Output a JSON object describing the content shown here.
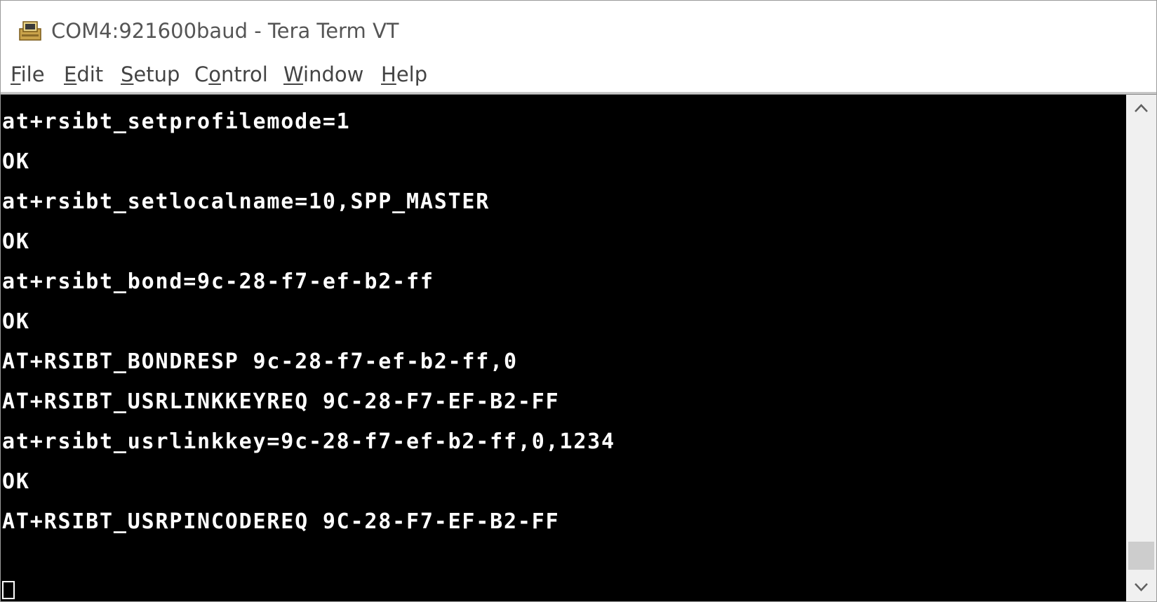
{
  "window": {
    "title": "COM4:921600baud - Tera Term VT"
  },
  "menu": {
    "items": [
      {
        "mnemonic": "F",
        "rest": "ile"
      },
      {
        "mnemonic": "E",
        "rest": "dit"
      },
      {
        "mnemonic": "S",
        "rest": "etup"
      },
      {
        "pre": "C",
        "mnemonic": "o",
        "rest": "ntrol"
      },
      {
        "mnemonic": "W",
        "rest": "indow"
      },
      {
        "mnemonic": "H",
        "rest": "elp"
      }
    ]
  },
  "terminal": {
    "lines": [
      "at+rsibt_setprofilemode=1",
      "OK",
      "at+rsibt_setlocalname=10,SPP_MASTER",
      "OK",
      "at+rsibt_bond=9c-28-f7-ef-b2-ff",
      "OK",
      "AT+RSIBT_BONDRESP 9c-28-f7-ef-b2-ff,0",
      "AT+RSIBT_USRLINKKEYREQ 9C-28-F7-EF-B2-FF",
      "at+rsibt_usrlinkkey=9c-28-f7-ef-b2-ff,0,1234",
      "OK",
      "AT+RSIBT_USRPINCODEREQ 9C-28-F7-EF-B2-FF"
    ],
    "background": "#000000",
    "foreground": "#ffffff"
  },
  "icons": {
    "app": "tera-term-app-icon",
    "minimize": "minimize-icon",
    "maximize": "maximize-icon",
    "close": "close-icon",
    "scroll_up": "chevron-up-icon",
    "scroll_down": "chevron-down-icon"
  }
}
